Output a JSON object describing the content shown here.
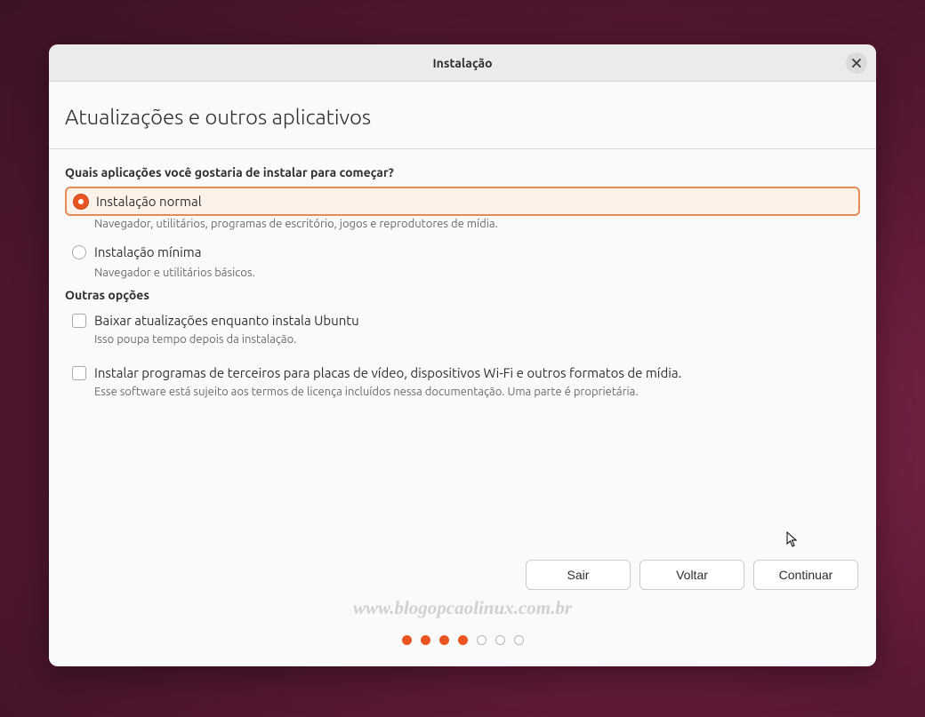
{
  "titlebar": {
    "title": "Instalação"
  },
  "page": {
    "title": "Atualizações e outros aplicativos"
  },
  "install_type": {
    "heading": "Quais aplicações você gostaria de instalar para começar?",
    "normal": {
      "label": "Instalação normal",
      "desc": "Navegador, utilitários, programas de escritório, jogos e reprodutores de mídia."
    },
    "minimal": {
      "label": "Instalação mínima",
      "desc": "Navegador e utilitários básicos."
    }
  },
  "other_options": {
    "heading": "Outras opções",
    "download_updates": {
      "label": "Baixar atualizações enquanto instala Ubuntu",
      "desc": "Isso poupa tempo depois da instalação."
    },
    "third_party": {
      "label": "Instalar programas de terceiros para placas de vídeo, dispositivos Wi-Fi e outros formatos de mídia.",
      "desc": "Esse software está sujeito aos termos de licença incluídos nessa documentação. Uma parte é proprietária."
    }
  },
  "buttons": {
    "quit": "Sair",
    "back": "Voltar",
    "continue": "Continuar"
  },
  "watermark": "www.blogopcaolinux.com.br",
  "progress": {
    "total": 7,
    "current": 4
  }
}
